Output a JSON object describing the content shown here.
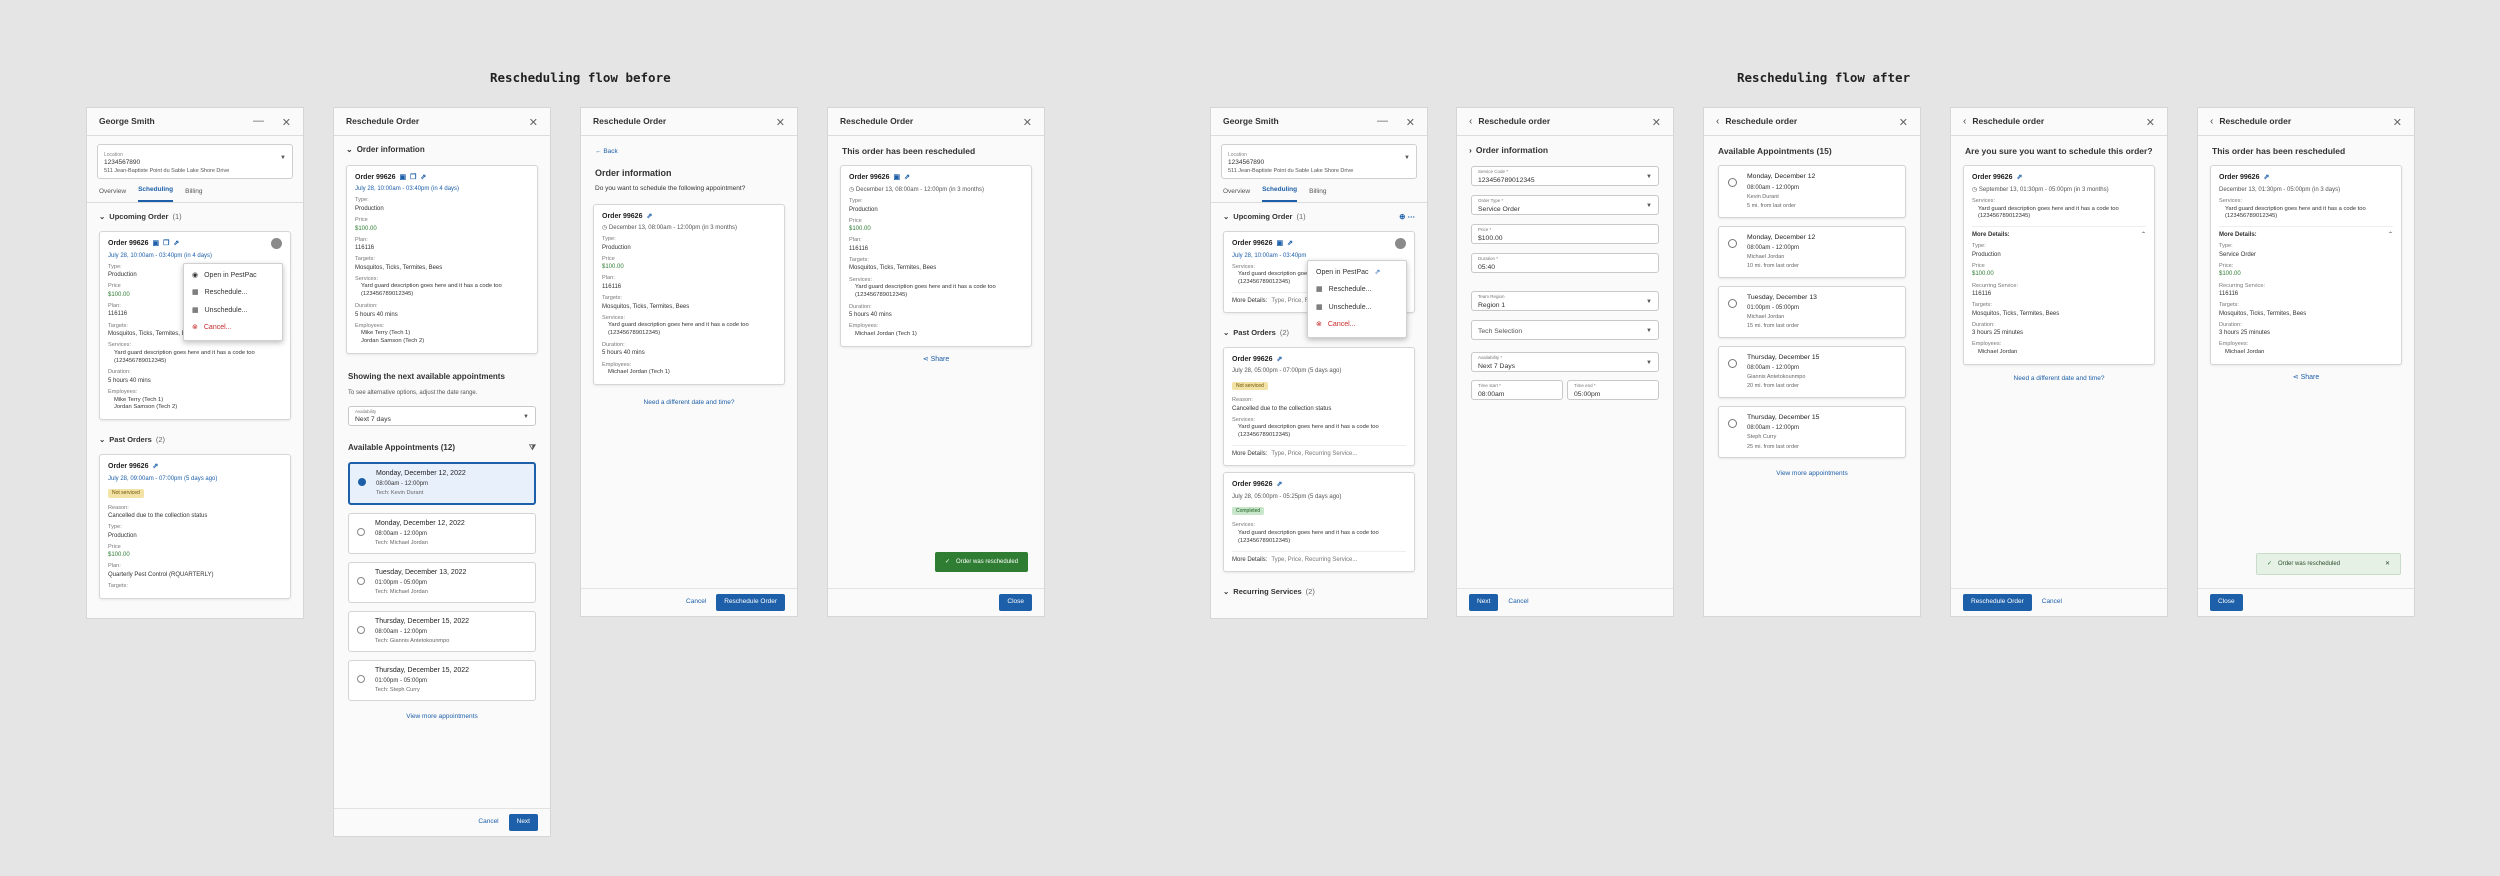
{
  "titles": {
    "before": "Rescheduling flow before",
    "after": "Rescheduling flow after"
  },
  "common": {
    "customer": "George Smith",
    "location_label": "Location",
    "location_id": "1234567890",
    "location_addr": "511 Jean-Baptiste Point du Sable Lake Shore Drive",
    "tabs": [
      "Overview",
      "Scheduling",
      "Billing"
    ],
    "order": "Order 99626",
    "type_l": "Type:",
    "type_v": "Production",
    "price_l": "Price",
    "price_v": "$100.00",
    "plan_l": "Plan:",
    "plan_v": "116116",
    "targets_l": "Targets:",
    "targets_v": "Mosquitos, Ticks, Termites, Bees",
    "services_l": "Services:",
    "service_desc": "Yard guard description goes here and it has a code too (123456789012345)",
    "duration_l": "Duration:",
    "duration_v": "5 hours 40 mins",
    "employees_l": "Employees:",
    "emp1": "Mike Terry (Tech 1)",
    "emp2": "Jordan Samson (Tech 2)",
    "emp_mj": "Michael Jordan (Tech 1)",
    "close": "Close",
    "cancel": "Cancel",
    "next": "Next",
    "back": "Back",
    "share": "Share",
    "need_diff": "Need a different date and time?",
    "view_more": "View more appointments",
    "toast": "Order was rescheduled",
    "reschedule_order": "Reschedule Order",
    "reschedule_order_lc": "Reschedule order",
    "rescheduled_title": "This order has been rescheduled",
    "menu": [
      "Open in PestPac",
      "Reschedule...",
      "Unschedule...",
      "Cancel..."
    ]
  },
  "b1": {
    "upcoming": "Upcoming Order",
    "upcoming_cnt": "(1)",
    "date": "July 28, 10:00am - 03:40pm (in 4 days)",
    "past": "Past Orders",
    "past_cnt": "(2)",
    "past_date": "July 28, 09:00am - 07:00pm (5 days ago)",
    "not_serviced": "Not serviced",
    "reason_l": "Reason:",
    "reason_v": "Cancelled due to the collection status",
    "plan_v": "Quarterly Pest Control (RQUARTERLY)",
    "targets_cut": "Targets:"
  },
  "b2": {
    "order_info": "Order information",
    "date": "July 28, 10:00am - 03:40pm (in 4 days)",
    "showing": "Showing the next available appointments",
    "adjust": "To see alternative options, adjust the date range.",
    "avail_l": "Availability",
    "avail_v": "Next 7 days",
    "avail_title": "Available Appointments (12)",
    "appts": [
      {
        "d": "Monday, December 12, 2022",
        "t": "08:00am - 12:00pm",
        "tech": "Tech: Kevin Durant"
      },
      {
        "d": "Monday, December 12, 2022",
        "t": "08:00am - 12:00pm",
        "tech": "Tech: Michael Jordan"
      },
      {
        "d": "Tuesday, December 13, 2022",
        "t": "01:00pm - 05:00pm",
        "tech": "Tech: Michael Jordan"
      },
      {
        "d": "Thursday, December 15, 2022",
        "t": "08:00am - 12:00pm",
        "tech": "Tech: Giannis Antetokounmpo"
      },
      {
        "d": "Thursday, December 15, 2022",
        "t": "01:00pm - 05:00pm",
        "tech": "Tech: Steph Curry"
      }
    ]
  },
  "b3": {
    "order_info": "Order information",
    "question": "Do you want to schedule the following appointment?",
    "date": "December 13, 08:00am - 12:00pm (in 3 months)"
  },
  "b4": {
    "date": "December 13, 08:00am - 12:00pm (in 3 months)"
  },
  "a1": {
    "upcoming": "Upcoming Order",
    "upcoming_cnt": "(1)",
    "date": "July 28, 10:00am - 03:40pm",
    "more_l": "More Details:",
    "more_v": "Type, Price, Recurring Service...",
    "past": "Past Orders",
    "past_cnt": "(2)",
    "past_date": "July 28, 05:00pm - 07:00pm (5 days ago)",
    "past2_date": "July 28, 05:00pm - 05:25pm (5 days ago)",
    "not_serviced": "Not serviced",
    "completed": "Completed",
    "reason_l": "Reason:",
    "reason_v": "Cancelled due to the collection status",
    "recurring": "Recurring Services",
    "recurring_cnt": "(2)"
  },
  "a2": {
    "order_info": "Order information",
    "fields": [
      {
        "l": "Service Code *",
        "v": "123456789012345",
        "dd": true
      },
      {
        "l": "Order Type *",
        "v": "Service Order",
        "dd": true
      },
      {
        "l": "Price *",
        "v": "$100.00",
        "dd": false
      },
      {
        "l": "Duration *",
        "v": "05:40",
        "dd": false
      }
    ],
    "team_l": "Team Region",
    "team_v": "Region 1",
    "tech_v": "Tech Selection",
    "avail_l": "Availability *",
    "avail_v": "Next 7 Days",
    "ts_l": "Time start *",
    "ts_v": "08:00am",
    "te_l": "Time end *",
    "te_v": "05:00pm"
  },
  "a3": {
    "avail_title": "Available Appointments (15)",
    "appts": [
      {
        "d": "Monday, December 12",
        "t": "08:00am - 12:00pm",
        "tech": "Kevin Durant",
        "ds": "5 mi. from last order"
      },
      {
        "d": "Monday, December 12",
        "t": "08:00am - 12:00pm",
        "tech": "Michael Jordan",
        "ds": "10 mi. from last order"
      },
      {
        "d": "Tuesday, December 13",
        "t": "01:00pm - 05:00pm",
        "tech": "Michael Jordan",
        "ds": "15 mi. from last order"
      },
      {
        "d": "Thursday, December 15",
        "t": "08:00am - 12:00pm",
        "tech": "Giannis Antetokounmpo",
        "ds": "20 mi. from last order"
      },
      {
        "d": "Thursday, December 15",
        "t": "08:00am - 12:00pm",
        "tech": "Steph Curry",
        "ds": "25 mi. from last order"
      }
    ]
  },
  "a4": {
    "question": "Are you sure you want to schedule this order?",
    "date": "September 13, 01:30pm - 05:00pm (in 3 months)",
    "more": "More Details:",
    "type_v": "Production",
    "rec_l": "Recurring Service:",
    "rec_v": "116116",
    "dur_v": "3 hours 25 minutes",
    "emp_v": "Michael Jordan"
  },
  "a5": {
    "date": "December 13, 01:30pm - 05:00pm (in 3 days)",
    "more": "More Details:",
    "type_v": "Service Order",
    "price_l": "Price:",
    "rec_l": "Recurring Service:",
    "rec_v": "116116",
    "dur_v": "3 hours 25 minutes",
    "emp_v": "Michael Jordan"
  }
}
